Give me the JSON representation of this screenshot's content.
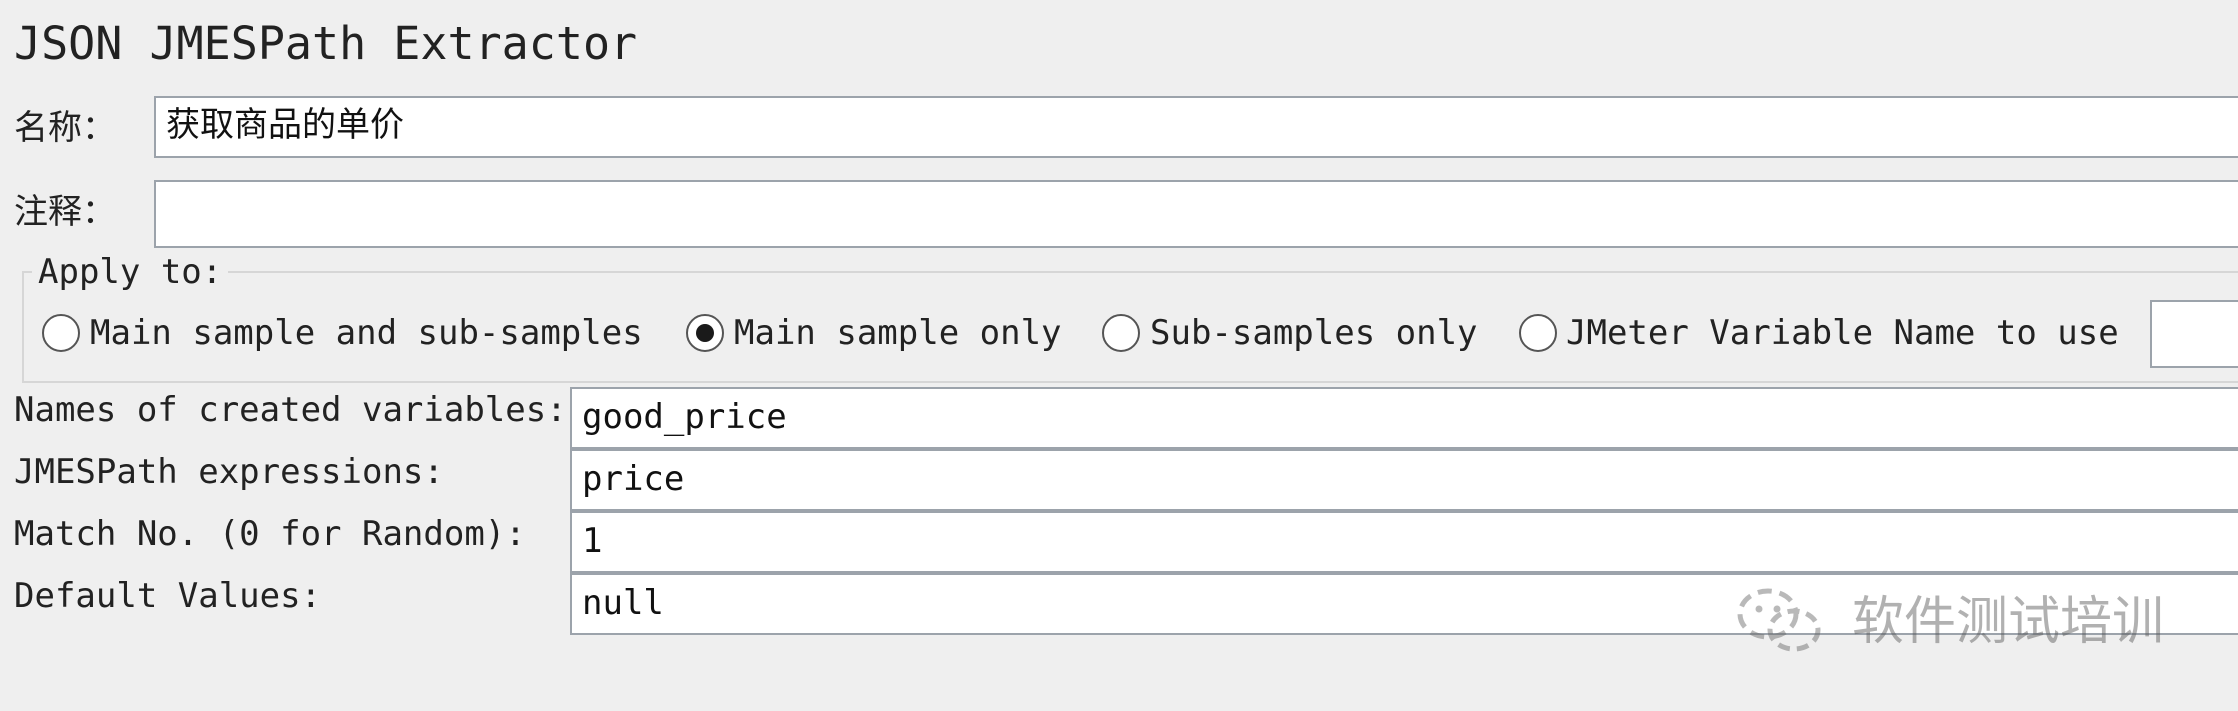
{
  "panel": {
    "title": "JSON JMESPath Extractor"
  },
  "name_field": {
    "label": "名称：",
    "value": "获取商品的单价"
  },
  "comment_field": {
    "label": "注释：",
    "value": ""
  },
  "apply_to": {
    "legend": "Apply to:",
    "options": [
      {
        "label": "Main sample and sub-samples",
        "selected": false
      },
      {
        "label": "Main sample only",
        "selected": true
      },
      {
        "label": "Sub-samples only",
        "selected": false
      },
      {
        "label": "JMeter Variable Name to use",
        "selected": false
      }
    ],
    "variable_name_value": ""
  },
  "form": {
    "variables_label": "Names of created variables:",
    "variables_value": "good_price",
    "expressions_label": "JMESPath expressions:",
    "expressions_value": "price",
    "match_label": "Match No. (0 for Random):",
    "match_value": "1",
    "default_label": "Default Values:",
    "default_value": "null"
  },
  "watermark": {
    "icon": "wechat-icon",
    "text": "软件测试培训"
  }
}
